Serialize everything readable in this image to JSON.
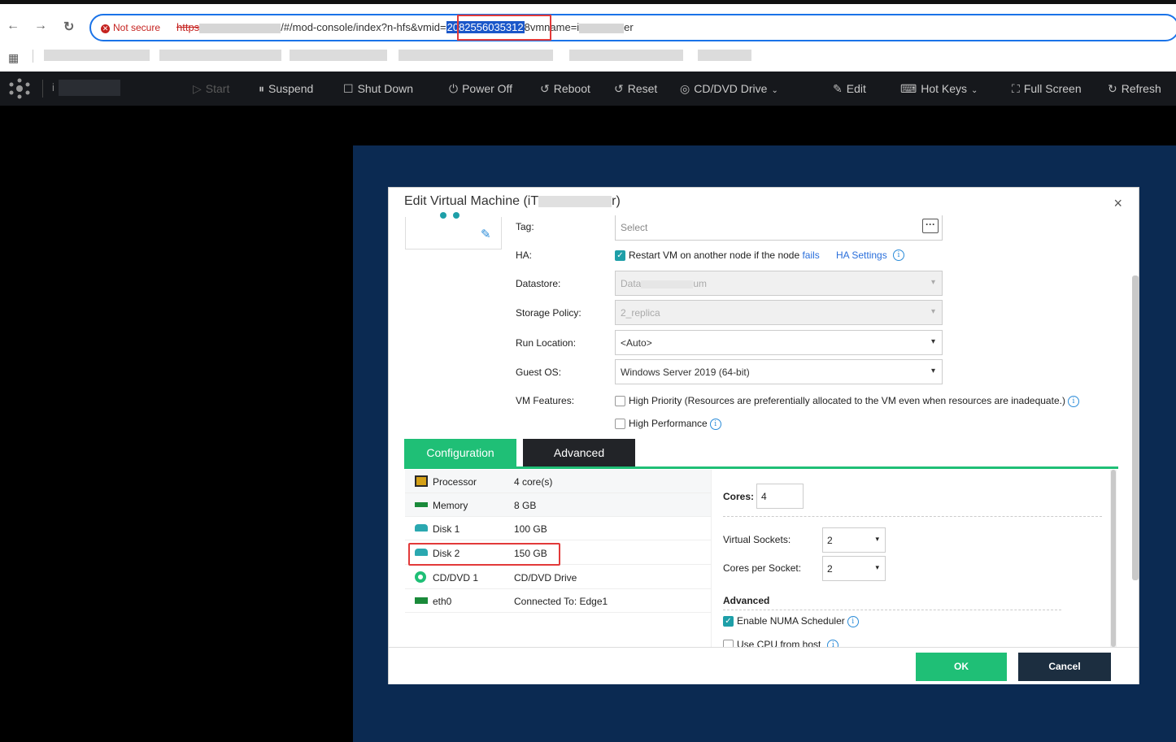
{
  "browser": {
    "nav": {
      "back": "←",
      "forward": "→",
      "reload": "↻"
    },
    "security_label": "Not secure",
    "url": {
      "scheme": "https",
      "path": "/#/mod-console/index?n-hfs&vmid=",
      "vmid_selected": "2082556035312",
      "rest": "8",
      "tail": "vmname=i",
      "tail_end": "er"
    },
    "apps_icon": "grid-icon"
  },
  "toolbar": {
    "vm_name": "i",
    "buttons": {
      "start": "Start",
      "suspend": "Suspend",
      "shutdown": "Shut Down",
      "poweroff": "Power Off",
      "reboot": "Reboot",
      "reset": "Reset",
      "cddvd": "CD/DVD Drive",
      "edit": "Edit",
      "hotkeys": "Hot Keys",
      "fullscreen": "Full Screen",
      "refresh": "Refresh"
    }
  },
  "modal": {
    "title_prefix": "Edit Virtual Machine (iT",
    "title_suffix": "r)",
    "fields": {
      "tag": {
        "label": "Tag:",
        "placeholder": "Select"
      },
      "ha": {
        "label": "HA:",
        "text": "Restart VM on another node if the node ",
        "link": "fails",
        "settings": "HA Settings",
        "checked": true
      },
      "datastore": {
        "label": "Datastore:",
        "value_prefix": "Data",
        "value_suffix": "um"
      },
      "storage_policy": {
        "label": "Storage Policy:",
        "value": "2_replica"
      },
      "run_location": {
        "label": "Run Location:",
        "value": "<Auto>"
      },
      "guest_os": {
        "label": "Guest OS:",
        "value": "Windows Server 2019 (64-bit)"
      },
      "vm_features": {
        "label": "VM Features:",
        "high_priority": "High Priority (Resources are preferentially allocated to the VM even when resources are inadequate.)",
        "high_performance": "High Performance"
      }
    },
    "tabs": {
      "configuration": "Configuration",
      "advanced": "Advanced"
    },
    "devices": [
      {
        "name": "Processor",
        "value": "4 core(s)",
        "icon": "processor-icon"
      },
      {
        "name": "Memory",
        "value": "8 GB",
        "icon": "memory-icon"
      },
      {
        "name": "Disk 1",
        "value": "100 GB",
        "icon": "disk-icon"
      },
      {
        "name": "Disk 2",
        "value": "150 GB",
        "icon": "disk-icon"
      },
      {
        "name": "CD/DVD 1",
        "value": "CD/DVD Drive",
        "icon": "cd-icon"
      },
      {
        "name": "eth0",
        "value": "Connected To: Edge1",
        "icon": "nic-icon"
      }
    ],
    "processor": {
      "cores_label": "Cores:",
      "cores_value": "4",
      "virtual_sockets_label": "Virtual Sockets:",
      "virtual_sockets_value": "2",
      "cores_per_socket_label": "Cores per Socket:",
      "cores_per_socket_value": "2",
      "advanced_heading": "Advanced",
      "numa_label": "Enable NUMA Scheduler",
      "numa_checked": true,
      "cpu_host_label": "Use CPU from host",
      "cpu_host_checked": false
    },
    "buttons": {
      "ok": "OK",
      "cancel": "Cancel"
    },
    "close": "×"
  },
  "colors": {
    "accent_green": "#1fbf76",
    "dark_tab": "#222428",
    "highlight_red": "#e23a3a",
    "console_bg": "#0b2a52"
  }
}
